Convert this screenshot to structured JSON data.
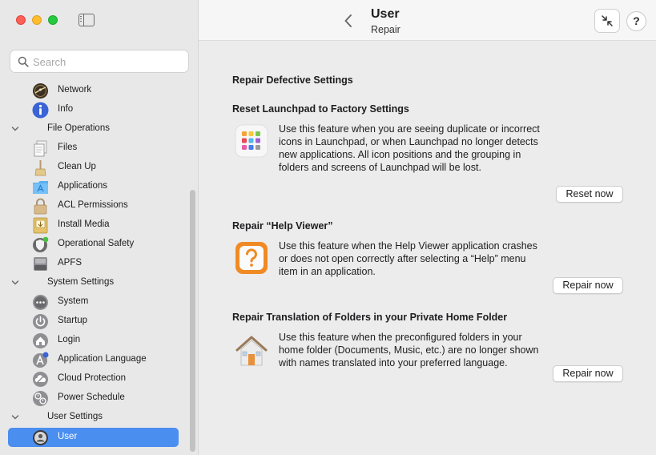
{
  "window": {
    "title": "User",
    "subtitle": "Repair",
    "help_label": "?"
  },
  "search": {
    "placeholder": "Search",
    "value": ""
  },
  "sidebar": {
    "items": [
      {
        "label": "Network",
        "icon": "network-icon",
        "type": "item"
      },
      {
        "label": "Info",
        "icon": "info-icon",
        "type": "item"
      },
      {
        "label": "File Operations",
        "type": "group",
        "expanded": true
      },
      {
        "label": "Files",
        "icon": "files-icon",
        "type": "item"
      },
      {
        "label": "Clean Up",
        "icon": "broom-icon",
        "type": "item"
      },
      {
        "label": "Applications",
        "icon": "applications-folder-icon",
        "type": "item"
      },
      {
        "label": "ACL Permissions",
        "icon": "lock-icon",
        "type": "item"
      },
      {
        "label": "Install Media",
        "icon": "install-media-icon",
        "type": "item"
      },
      {
        "label": "Operational Safety",
        "icon": "shield-icon",
        "type": "item"
      },
      {
        "label": "APFS",
        "icon": "drive-icon",
        "type": "item"
      },
      {
        "label": "System Settings",
        "type": "group",
        "expanded": true
      },
      {
        "label": "System",
        "icon": "ellipsis-circle-icon",
        "type": "item"
      },
      {
        "label": "Startup",
        "icon": "power-icon",
        "type": "item"
      },
      {
        "label": "Login",
        "icon": "house-icon",
        "type": "item"
      },
      {
        "label": "Application Language",
        "icon": "app-language-icon",
        "type": "item"
      },
      {
        "label": "Cloud Protection",
        "icon": "cloud-icon",
        "type": "item"
      },
      {
        "label": "Power Schedule",
        "icon": "power-schedule-icon",
        "type": "item"
      },
      {
        "label": "User Settings",
        "type": "group",
        "expanded": true
      },
      {
        "label": "User",
        "icon": "user-icon",
        "type": "item",
        "selected": true
      }
    ]
  },
  "content": {
    "section_title": "Repair Defective Settings",
    "features": [
      {
        "title": "Reset Launchpad to Factory Settings",
        "icon": "launchpad-icon",
        "description": "Use this feature when you are seeing duplicate or incorrect icons in Launchpad, or when Launchpad no longer detects new applications. All icon positions and the grouping in folders and screens of Launchpad will be lost.",
        "button": "Reset now"
      },
      {
        "title": "Repair “Help Viewer”",
        "icon": "help-viewer-icon",
        "description": "Use this feature when the Help Viewer application crashes or does not open correctly after selecting a “Help” menu item in an application.",
        "button": "Repair now"
      },
      {
        "title": "Repair Translation of Folders in your Private Home Folder",
        "icon": "home-folder-icon",
        "description": "Use this feature when the preconfigured folders in your home folder (Documents, Music, etc.) are no longer shown with names translated into your preferred language.",
        "button": "Repair now"
      }
    ]
  },
  "colors": {
    "accent": "#4a8ef0",
    "traffic_red": "#fe5f57",
    "traffic_yellow": "#febc2e",
    "traffic_green": "#28c840"
  }
}
